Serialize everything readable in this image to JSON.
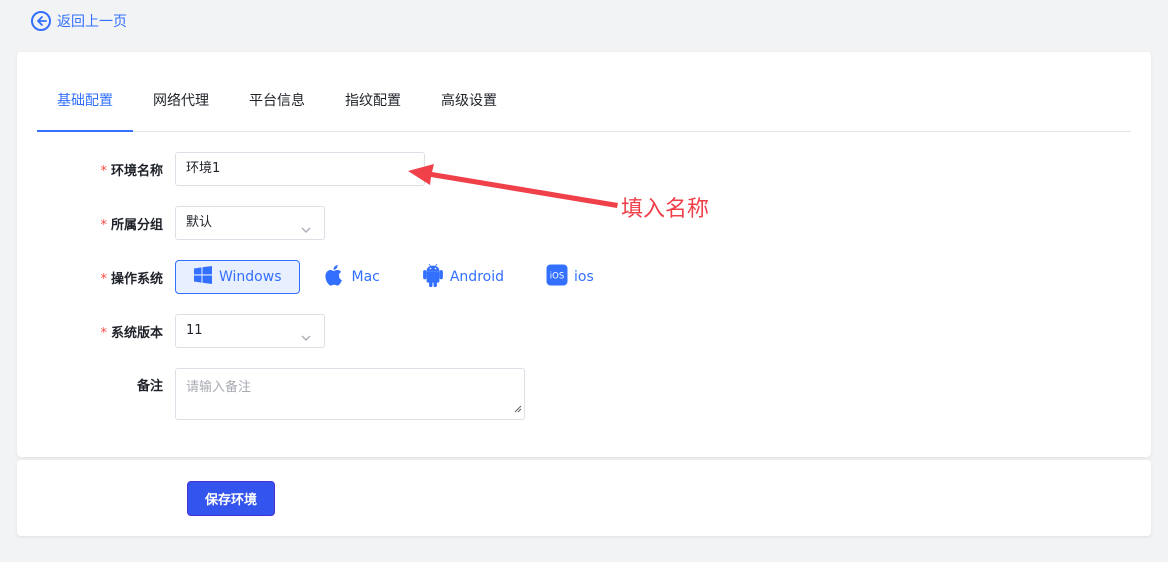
{
  "back": {
    "label": "返回上一页"
  },
  "tabs": [
    {
      "label": "基础配置",
      "active": true
    },
    {
      "label": "网络代理"
    },
    {
      "label": "平台信息"
    },
    {
      "label": "指纹配置"
    },
    {
      "label": "高级设置"
    }
  ],
  "form": {
    "required_mark": "*",
    "env_name": {
      "label": "环境名称",
      "value": "环境1"
    },
    "group": {
      "label": "所属分组",
      "value": "默认"
    },
    "os": {
      "label": "操作系统",
      "options": [
        {
          "label": "Windows",
          "icon": "windows-icon",
          "selected": true
        },
        {
          "label": "Mac",
          "icon": "apple-icon"
        },
        {
          "label": "Android",
          "icon": "android-icon"
        },
        {
          "label": "ios",
          "icon": "ios-icon"
        }
      ]
    },
    "version": {
      "label": "系统版本",
      "value": "11"
    },
    "remark": {
      "label": "备注",
      "placeholder": "请输入备注"
    }
  },
  "footer": {
    "save_label": "保存环境"
  },
  "annotation": {
    "text": "填入名称",
    "color": "#f0404a"
  },
  "colors": {
    "accent": "#3370ff",
    "save_button": "#3355ee",
    "required": "#f54a45"
  }
}
